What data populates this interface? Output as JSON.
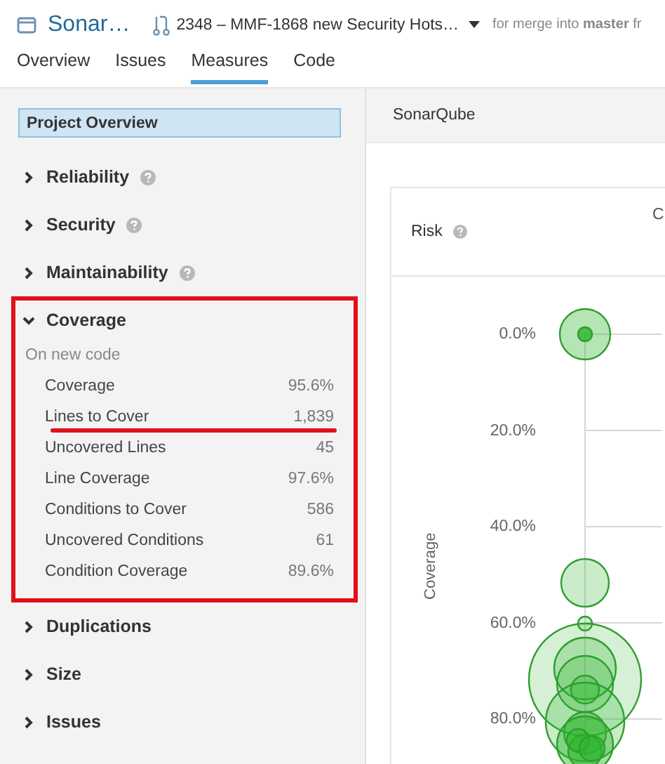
{
  "header": {
    "project": "Sonar…",
    "pull_request": "2348 – MMF-1868 new Security Hots…",
    "merge_info": "for merge into **master** fr"
  },
  "tabs": [
    {
      "label": "Overview",
      "selected": false
    },
    {
      "label": "Issues",
      "selected": false
    },
    {
      "label": "Measures",
      "selected": true
    },
    {
      "label": "Code",
      "selected": false
    }
  ],
  "sidebar": {
    "overview": {
      "label": "Project Overview",
      "selected": true
    },
    "groups": [
      {
        "label": "Reliability",
        "expanded": false,
        "help": true,
        "highlighted": false
      },
      {
        "label": "Security",
        "expanded": false,
        "help": true,
        "highlighted": false
      },
      {
        "label": "Maintainability",
        "expanded": false,
        "help": true,
        "highlighted": false
      },
      {
        "label": "Coverage",
        "expanded": true,
        "help": false,
        "highlighted": true,
        "subheading": "On new code",
        "metrics": [
          {
            "name": "Coverage",
            "value": "95.6%",
            "underlined": false
          },
          {
            "name": "Lines to Cover",
            "value": "1,839",
            "underlined": true
          },
          {
            "name": "Uncovered Lines",
            "value": "45",
            "underlined": false
          },
          {
            "name": "Line Coverage",
            "value": "97.6%",
            "underlined": false
          },
          {
            "name": "Conditions to Cover",
            "value": "586",
            "underlined": false
          },
          {
            "name": "Uncovered Conditions",
            "value": "61",
            "underlined": false
          },
          {
            "name": "Condition Coverage",
            "value": "89.6%",
            "underlined": false
          }
        ]
      },
      {
        "label": "Duplications",
        "expanded": false,
        "help": false,
        "highlighted": false
      },
      {
        "label": "Size",
        "expanded": false,
        "help": false,
        "highlighted": false
      },
      {
        "label": "Issues",
        "expanded": false,
        "help": false,
        "highlighted": false
      }
    ]
  },
  "main": {
    "breadcrumb": "SonarQube",
    "chart": {
      "title": "Risk",
      "help": true,
      "column_2": "C",
      "y_axis_label": "Coverage",
      "y_ticks": [
        "0.0%",
        "20.0%",
        "40.0%",
        "60.0%",
        "80.0%"
      ]
    }
  }
}
